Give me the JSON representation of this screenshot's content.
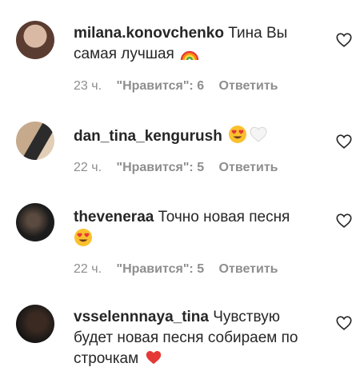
{
  "comments": [
    {
      "username": "milana.konovchenko",
      "text": "Тина Вы самая лучшая",
      "emoji": [
        "rainbow-emoji"
      ],
      "time": "23 ч.",
      "likes": "\"Нравится\": 6",
      "reply": "Ответить"
    },
    {
      "username": "dan_tina_kengurush",
      "text": "",
      "emoji": [
        "heart-eyes-emoji",
        "white-heart-emoji"
      ],
      "time": "22 ч.",
      "likes": "\"Нравится\": 5",
      "reply": "Ответить"
    },
    {
      "username": "theveneraa",
      "text": "Точно новая песня",
      "emoji": [
        "heart-eyes-emoji"
      ],
      "time": "22 ч.",
      "likes": "\"Нравится\": 5",
      "reply": "Ответить"
    },
    {
      "username": "vsselennnaya_tina",
      "text": "Чувствую будет новая песня собираем по строчкам",
      "emoji": [
        "red-heart-emoji"
      ],
      "time": "",
      "likes": "",
      "reply": ""
    }
  ],
  "icons": {
    "like": "heart-outline-icon"
  },
  "colors": {
    "text": "#262626",
    "meta": "#8e8e8e",
    "background": "#ffffff"
  }
}
